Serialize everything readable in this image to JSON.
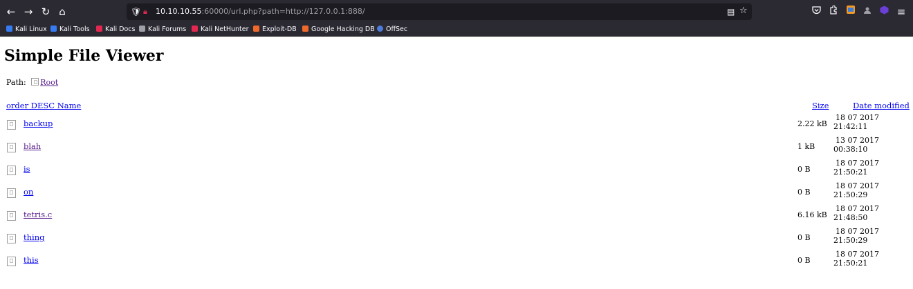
{
  "browser": {
    "url_host": "10.10.10.55",
    "url_rest": ":60000/url.php?path=http://127.0.0.1:888/",
    "bookmarks": [
      {
        "label": "Kali Linux",
        "color": "#367bf0"
      },
      {
        "label": "Kali Tools",
        "color": "#367bf0"
      },
      {
        "label": "Kali Docs",
        "color": "#e22850"
      },
      {
        "label": "Kali Forums",
        "color": "#9f9fa6"
      },
      {
        "label": "Kali NetHunter",
        "color": "#e22850"
      },
      {
        "label": "Exploit-DB",
        "color": "#ef6a2a"
      },
      {
        "label": "Google Hacking DB",
        "color": "#ef6a2a"
      },
      {
        "label": "OffSec",
        "color": "#4c7bd9"
      }
    ],
    "icons": {
      "back": "←",
      "forward": "→",
      "reload": "↻",
      "home": "⌂",
      "reader": "▤",
      "bookmark_star": "☆",
      "pocket": "pocket-icon",
      "extensions": "extensions-icon",
      "burp": "burp-icon",
      "profile": "account-icon",
      "container": "container-icon",
      "menu": "≡"
    }
  },
  "page": {
    "title": "Simple File Viewer",
    "path_label": "Path:",
    "root_link": "Root",
    "headers": {
      "name": "order DESC Name",
      "size": "Size",
      "date": "Date modified"
    },
    "files": [
      {
        "name": "backup",
        "size": "2.22 kB",
        "date_line1": "18 07 2017",
        "date_line2": "21:42:11",
        "visited": false
      },
      {
        "name": "blah",
        "size": "1 kB",
        "date_line1": "13 07 2017",
        "date_line2": "00:38:10",
        "visited": true
      },
      {
        "name": "is",
        "size": "0 B",
        "date_line1": "18 07 2017",
        "date_line2": "21:50:21",
        "visited": false
      },
      {
        "name": "on",
        "size": "0 B",
        "date_line1": "18 07 2017",
        "date_line2": "21:50:29",
        "visited": false
      },
      {
        "name": "tetris.c",
        "size": "6.16 kB",
        "date_line1": "18 07 2017",
        "date_line2": "21:48:50",
        "visited": true
      },
      {
        "name": "thing",
        "size": "0 B",
        "date_line1": "18 07 2017",
        "date_line2": "21:50:29",
        "visited": false
      },
      {
        "name": "this",
        "size": "0 B",
        "date_line1": "18 07 2017",
        "date_line2": "21:50:21",
        "visited": false
      }
    ]
  }
}
